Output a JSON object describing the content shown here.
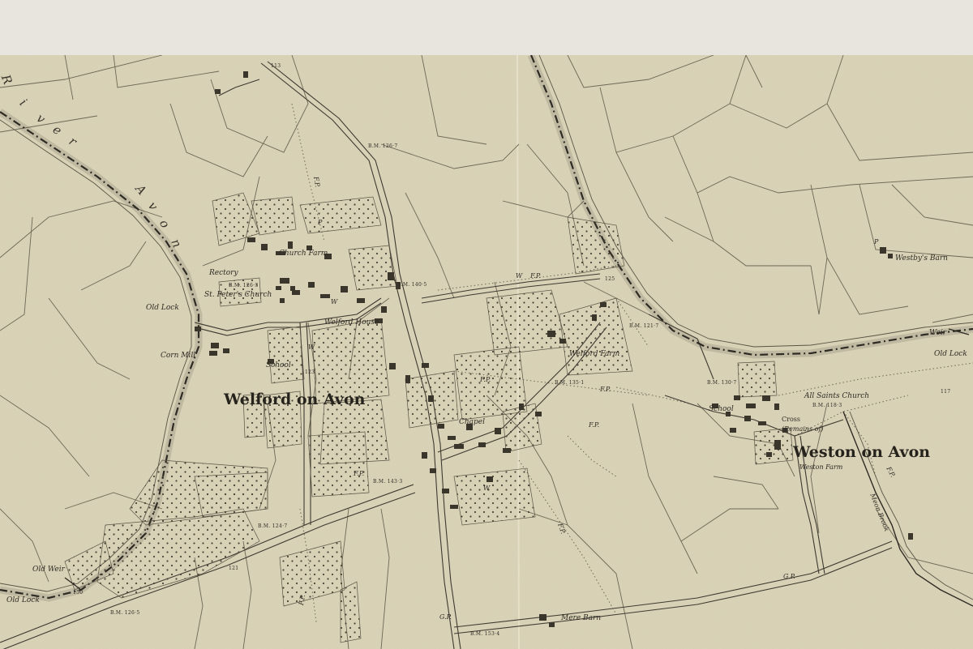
{
  "map": {
    "towns": {
      "welford": "Welford on Avon",
      "weston": "Weston on Avon"
    },
    "river": [
      "R",
      "i",
      "v",
      "e",
      "r",
      "A",
      "v",
      "o",
      "n"
    ],
    "labels": {
      "church_farm": "Church Farm",
      "rectory": "Rectory",
      "st_peters": "St. Peter's Church",
      "old_lock_1": "Old Lock",
      "old_lock_2": "Old Lock",
      "old_lock_3": "Old Lock",
      "corn_mill": "Corn Mill",
      "welford_house": "Welford House",
      "school_1": "School",
      "school_2": "School",
      "welford_farm": "Welford Farm",
      "chapel": "Chapel",
      "all_saints": "All Saints Church",
      "cross": "Cross",
      "cross_remains": "(Remains of)",
      "weston_farm": "Weston Farm",
      "westbys_barn": "Westby's Barn",
      "mere_barn": "Mere Barn",
      "old_weir": "Old Weir",
      "weir": "Weir",
      "meon_brook": "Meon Brook"
    },
    "benchmarks": {
      "bm_1267": "B.M. 126·7",
      "bm_1263": "B.M. 126·3",
      "bm_1405": "B.M. 140·5",
      "bm_1217": "B.M. 121·7",
      "bm_1351": "B.M. 135·1",
      "bm_1307": "B.M. 130·7",
      "bm_1183": "B.M. 118·3",
      "bm_1433": "B.M. 143·3",
      "bm_1247": "B.M. 124·7",
      "bm_1265": "B.M. 126·5",
      "bm_1534": "B.M. 153·4"
    },
    "spot": {
      "s113": "113",
      "s125": "125",
      "s123": "123",
      "s117": "117",
      "s121": "121",
      "s150": "150"
    },
    "abbrev": {
      "fp1": "F.P.",
      "fp2": "F.P.",
      "fp3": "F.P.",
      "fp4": "F.P.",
      "fp5": "F.P.",
      "fp6": "F.P.",
      "fp7": "F.P.",
      "fp8": "F.P.",
      "fp9": "F.P.",
      "gp1": "G.P.",
      "gp2": "G.P.",
      "w1": "W",
      "w2": "W",
      "w3": "W",
      "w4": "W",
      "p1": "P",
      "p2": "P"
    }
  },
  "colors": {
    "paper": "#d9d2b6",
    "ink": "#2e2b24",
    "band": "#e8e4de"
  }
}
